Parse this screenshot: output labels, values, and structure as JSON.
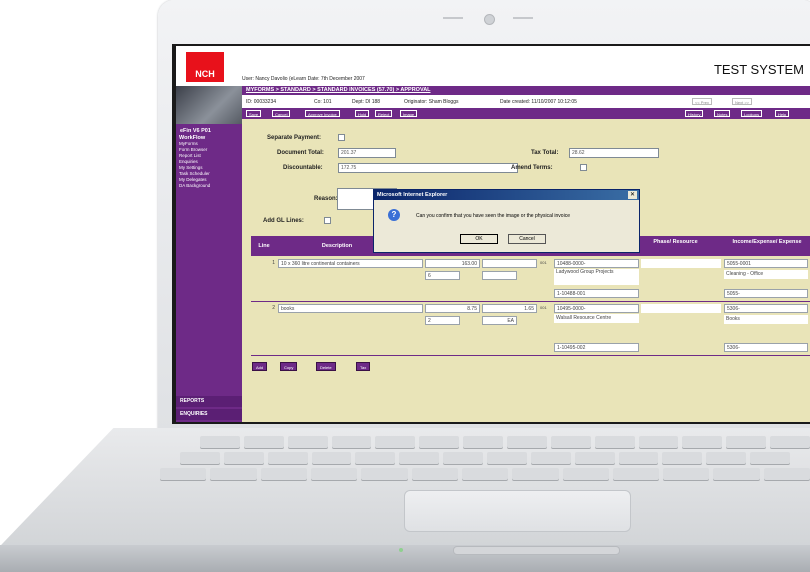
{
  "app": {
    "user_line": "User: Nancy Davolio (eLearn      Date: 7th December 2007",
    "system_name": "TEST SYSTEM",
    "logo_text": "NCH",
    "breadcrumb": "MYFORMS > STANDARD > STANDARD INVOICES (57.70) > APPROVAL"
  },
  "info": {
    "id": "ID: 00033234",
    "co": "Co: 101",
    "dept": "Dept: DI 188",
    "originator": "Originator: Sham Bloggs",
    "created": "Date created: 11/10/2007 10:12:05"
  },
  "toolbar": {
    "buttons": [
      "Save",
      "Cancel",
      "Approve Invoice",
      "Hold",
      "Reject",
      "Image"
    ],
    "right_buttons": [
      "History",
      "Notes",
      "Lookups",
      "Help"
    ],
    "nav_buttons": [
      "<< Prev",
      "Next >>"
    ]
  },
  "sidebar": {
    "title": "eFin V6 P01",
    "items": [
      {
        "label": "WorkFlow",
        "header": true
      },
      {
        "label": "MyForms"
      },
      {
        "label": "Form Browser"
      },
      {
        "label": "Report List"
      },
      {
        "label": "Enquiries"
      },
      {
        "label": "My Settings"
      },
      {
        "label": "Task Scheduler"
      },
      {
        "label": "My Delegates"
      },
      {
        "label": "DA Background"
      }
    ],
    "reports": "REPORTS",
    "enquiries": "ENQUIRIES"
  },
  "form": {
    "separate_payment_label": "Separate Payment:",
    "document_total_label": "Document Total:",
    "document_total": "201.37",
    "discountable_label": "Discountable:",
    "discountable": "172.75",
    "tax_total_label": "Tax Total:",
    "tax_total": "28.62",
    "amend_terms_label": "Amend Terms:",
    "reason_label": "Reason:",
    "add_gl_lines_label": "Add GL Lines:"
  },
  "grid": {
    "headers": [
      "Line",
      "Description",
      "Phase/ Resource",
      "Income/Expense/ Expense"
    ],
    "rows": [
      {
        "line": "1",
        "description": "10 x 360 litre continental containers",
        "amount": "163.00",
        "qty": "6",
        "company": "001",
        "cost_centre": "10488-0000-",
        "resource_desc": "Ladywood Group Projects",
        "resource_code": "1-10488-001",
        "income_code": "5055-0001",
        "income_desc": "Cleaning - Office",
        "income_code2": "5055-"
      },
      {
        "line": "2",
        "description": "books",
        "amount": "8.75",
        "qty": "2",
        "unit": "EA",
        "amount2": "1.65",
        "company": "001",
        "cost_centre": "10495-0000-",
        "resource_desc": "Walsall Resource Centre",
        "resource_code": "1-10495-002",
        "income_code": "5306-",
        "income_desc": "Books",
        "income_code2": "5306-"
      }
    ],
    "buttons": [
      "Add",
      "Copy",
      "Delete",
      "Tax"
    ]
  },
  "dialog": {
    "title": "Microsoft Internet Explorer",
    "message": "Can you confirm that you have seen the image or the physical invoice",
    "ok": "OK",
    "cancel": "Cancel"
  }
}
